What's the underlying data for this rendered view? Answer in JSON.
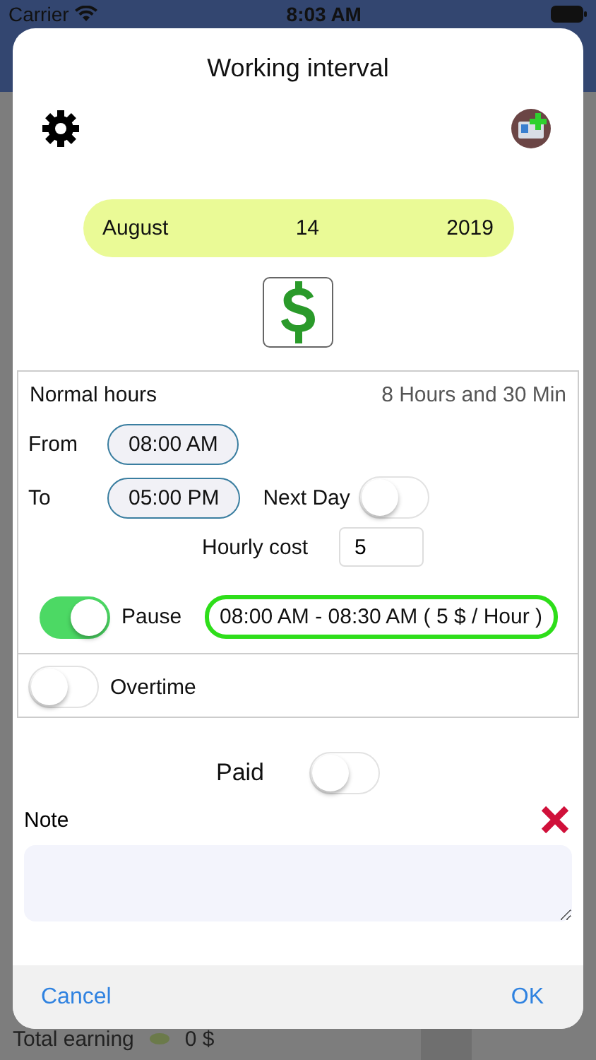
{
  "status_bar": {
    "carrier": "Carrier",
    "time": "8:03 AM"
  },
  "background": {
    "total_label": "Total earning",
    "total_value": "0 $"
  },
  "dialog": {
    "title": "Working interval",
    "date": {
      "month": "August",
      "day": "14",
      "year": "2019"
    },
    "normal_hours": {
      "label": "Normal hours",
      "duration": "8 Hours and 30 Min",
      "from_label": "From",
      "from_value": "08:00 AM",
      "to_label": "To",
      "to_value": "05:00 PM",
      "next_day": {
        "label": "Next Day",
        "on": false
      },
      "hourly_cost": {
        "label": "Hourly cost",
        "value": "5"
      },
      "pause": {
        "label": "Pause",
        "on": true,
        "value": "08:00 AM - 08:30 AM ( 5 $ / Hour )"
      }
    },
    "overtime": {
      "label": "Overtime",
      "on": false
    },
    "paid": {
      "label": "Paid",
      "on": false
    },
    "note": {
      "label": "Note"
    },
    "buttons": [
      "Cancel",
      "OK"
    ]
  }
}
